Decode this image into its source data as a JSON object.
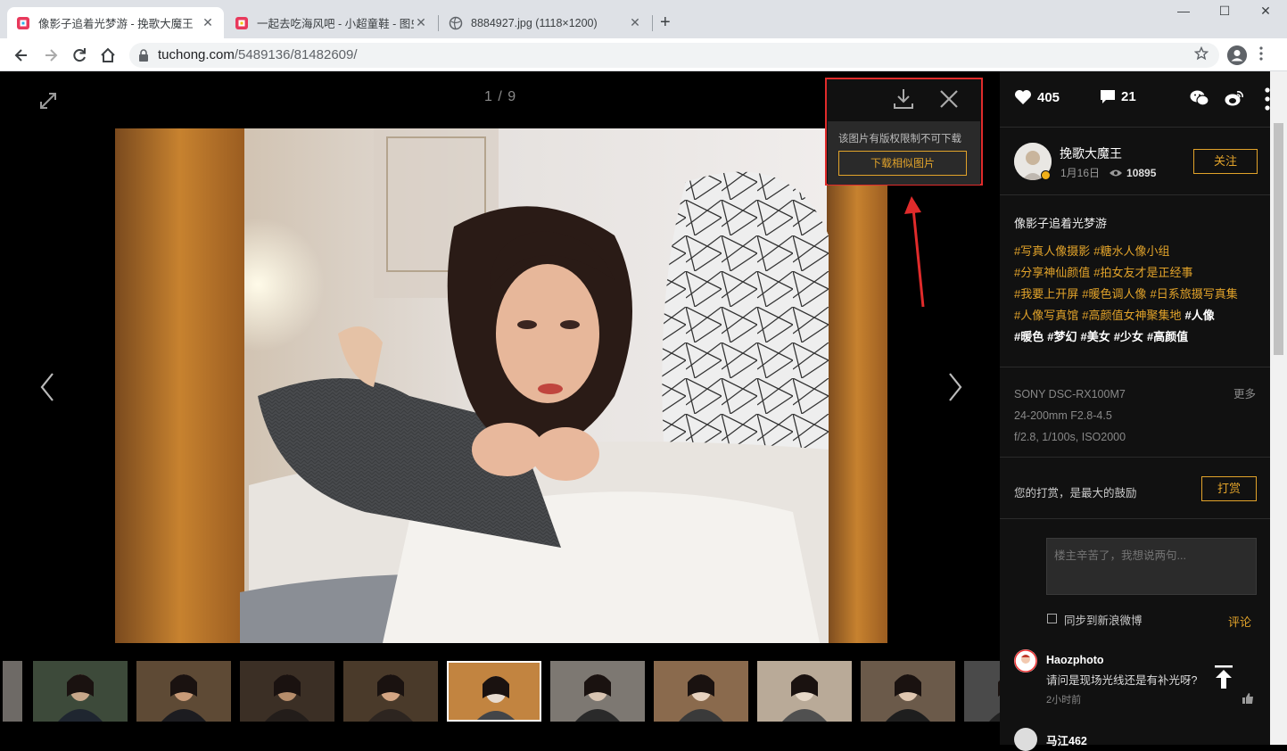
{
  "browser": {
    "tabs": [
      {
        "title": "像影子追着光梦游 - 挽歌大魔王",
        "active": true
      },
      {
        "title": "一起去吃海风吧 - 小超童鞋 - 图虫",
        "active": false
      },
      {
        "title": "8884927.jpg (1118×1200)",
        "active": false
      }
    ],
    "close_glyph": "✕",
    "new_tab": "+",
    "window_controls": {
      "minimize": "—",
      "maximize": "☐",
      "close": "✕"
    },
    "url_host": "tuchong.com",
    "url_path": "/5489136/81482609/"
  },
  "viewer": {
    "counter": "1 / 9",
    "download_notice": "该图片有版权限制不可下载",
    "download_similar": "下载相似图片",
    "annotation_color": "#e02b2b",
    "thumbnail_count": 10,
    "selected_thumbnail": 5
  },
  "sidebar": {
    "likes": "405",
    "comments": "21",
    "author": "挽歌大魔王",
    "date": "1月16日",
    "views": "10895",
    "follow": "关注",
    "album_title": "像影子追着光梦游",
    "tag_lines": [
      [
        {
          "t": "#写真人像摄影",
          "w": false
        },
        {
          "t": "#糖水人像小组",
          "w": false
        }
      ],
      [
        {
          "t": "#分享神仙颜值",
          "w": false
        },
        {
          "t": "#拍女友才是正经事",
          "w": false
        }
      ],
      [
        {
          "t": "#我要上开屏",
          "w": false
        },
        {
          "t": "#暖色调人像",
          "w": false
        },
        {
          "t": "#日系旅摄写真集",
          "w": false
        }
      ],
      [
        {
          "t": "#人像写真馆",
          "w": false
        },
        {
          "t": "#高颜值女神聚集地",
          "w": false
        },
        {
          "t": "#人像",
          "w": true
        }
      ],
      [
        {
          "t": "#暖色",
          "w": true
        },
        {
          "t": "#梦幻",
          "w": true
        },
        {
          "t": "#美女",
          "w": true
        },
        {
          "t": "#少女",
          "w": true
        },
        {
          "t": "#高颜值",
          "w": true
        }
      ]
    ],
    "camera": "SONY DSC-RX100M7",
    "lens": "24-200mm F2.8-4.5",
    "settings": "f/2.8, 1/100s, ISO2000",
    "exif_more": "更多",
    "reward_text": "您的打赏，是最大的鼓励",
    "reward_button": "打赏",
    "comment_placeholder": "楼主辛苦了，我想说两句...",
    "sync_weibo": "同步到新浪微博",
    "post_comment": "评论",
    "comment_items": [
      {
        "user": "Haozphoto",
        "text": "请问是现场光线还是有补光呀?",
        "time": "2小时前"
      },
      {
        "user": "马江462"
      }
    ],
    "accent_color": "#e2a32a"
  }
}
